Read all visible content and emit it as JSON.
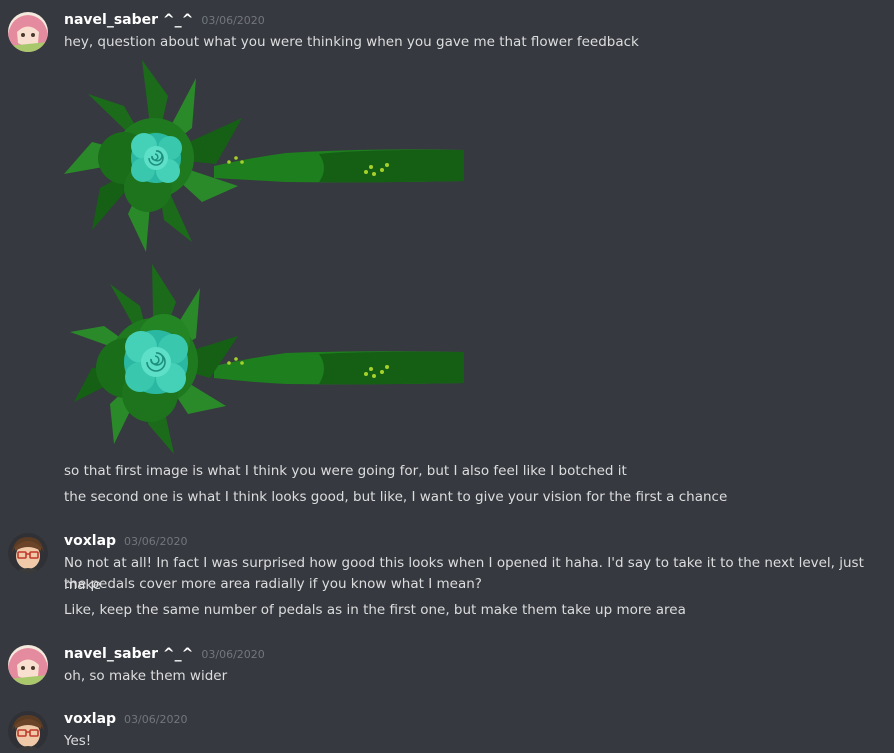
{
  "colors": {
    "background": "#36393f",
    "username": "#ffffff",
    "timestamp": "#72767d",
    "text": "#dcddde"
  },
  "messages": [
    {
      "author": "navel_saber ^_^",
      "timestamp": "03/06/2020",
      "avatar_icon": "anime-avatar-icon",
      "lines": [
        "hey, question about what you were thinking when you gave me that flower feedback"
      ],
      "attachments": [
        {
          "icon": "flower-sketch-image",
          "description_hidden": true
        },
        {
          "icon": "flower-sketch-image",
          "description_hidden": true
        }
      ],
      "after_lines": [
        "so that first image is what I think you were going for, but I also feel like I botched it",
        "the second one is what I think looks good, but like, I want to give your vision for the first a chance"
      ]
    },
    {
      "author": "voxlap",
      "timestamp": "03/06/2020",
      "avatar_icon": "glasses-avatar-icon",
      "lines": [
        "No not at all! In fact I was surprised how good this looks when I opened it haha. I'd say to take it to the next level, just make",
        "the pedals cover more area radially if you know what I mean?",
        "Like, keep the same number of pedals as in the first one, but make them take up more area"
      ]
    },
    {
      "author": "navel_saber ^_^",
      "timestamp": "03/06/2020",
      "avatar_icon": "anime-avatar-icon",
      "lines": [
        "oh, so make them wider"
      ]
    },
    {
      "author": "voxlap",
      "timestamp": "03/06/2020",
      "avatar_icon": "glasses-avatar-icon",
      "lines": [
        "Yes!"
      ]
    }
  ]
}
